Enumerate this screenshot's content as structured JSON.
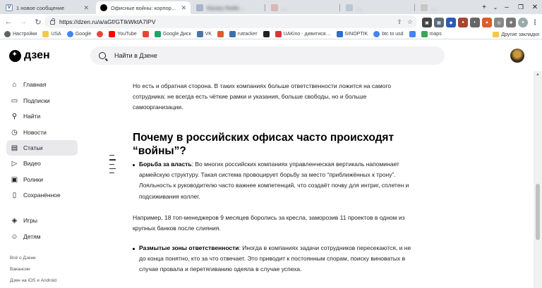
{
  "browser": {
    "tabs": [
      {
        "title": "1 новое сообщение",
        "favicon": "v-mail-icon"
      },
      {
        "title": "Офисные войны: корпоративн…",
        "favicon": "dzen-icon"
      },
      {
        "title": "Ranary Radio…",
        "favicon": "site-icon"
      },
      {
        "title": "…",
        "favicon": "site-icon"
      },
      {
        "title": "…",
        "favicon": "site-icon"
      },
      {
        "title": "…",
        "favicon": "site-icon"
      }
    ],
    "url": "https://dzen.ru/a/aGf/GTIkWktA7IPV",
    "bookmarks": [
      {
        "label": "Настройки",
        "color": "#5f6368"
      },
      {
        "label": "USA",
        "color": "#f2c94c"
      },
      {
        "label": "Google",
        "color": "#4285f4"
      },
      {
        "label": "",
        "color": "#e8453c"
      },
      {
        "label": "YouTube",
        "color": "#ff0000"
      },
      {
        "label": "",
        "color": "#ea4335"
      },
      {
        "label": "Google Диск",
        "color": "#1fa463"
      },
      {
        "label": "VK",
        "color": "#4a76a8"
      },
      {
        "label": "",
        "color": "#e05a2b"
      },
      {
        "label": "rutracker",
        "color": "#3a6fb0"
      },
      {
        "label": "",
        "color": "#222222"
      },
      {
        "label": "UAKino - дивитися…",
        "color": "#d33"
      },
      {
        "label": "SINOPTIK",
        "color": "#2d6fd1"
      },
      {
        "label": "btc to usd",
        "color": "#4285f4"
      },
      {
        "label": "",
        "color": "#4285f4"
      },
      {
        "label": "maps",
        "color": "#34a853"
      }
    ],
    "other_bookmarks": "Другие закладки"
  },
  "header": {
    "logo": "дзен",
    "search_placeholder": "Найти в Дзене"
  },
  "sidebar": {
    "items": [
      {
        "label": "Главная",
        "icon": "home-icon",
        "glyph": "⌂"
      },
      {
        "label": "Подписки",
        "icon": "subscriptions-icon",
        "glyph": "▭"
      },
      {
        "label": "Найти",
        "icon": "search-icon",
        "glyph": "⚲"
      },
      {
        "label": "Новости",
        "icon": "news-icon",
        "glyph": "◷"
      },
      {
        "label": "Статьи",
        "icon": "articles-icon",
        "glyph": "▤"
      },
      {
        "label": "Видео",
        "icon": "video-icon",
        "glyph": "▷"
      },
      {
        "label": "Ролики",
        "icon": "shorts-icon",
        "glyph": "▣"
      },
      {
        "label": "Сохранённое",
        "icon": "bookmark-icon",
        "glyph": "▯"
      },
      {
        "label": "Игры",
        "icon": "games-icon",
        "glyph": "◈"
      },
      {
        "label": "Детям",
        "icon": "kids-icon",
        "glyph": "☺"
      }
    ],
    "footer_links": [
      "Всё о Дзене",
      "Вакансии",
      "Дзен на iOS и Android"
    ]
  },
  "article": {
    "intro": "Но есть и обратная сторона. В таких компаниях больше ответственности ложится на самого сотрудника: не всегда есть чёткие рамки и указания, больше свободы, но и больше самоорганизации.",
    "heading": "Почему в российских офисах часто происходят “войны”?",
    "bullet1_bold": "Борьба за власть",
    "bullet1_text": ": Во многих российских компаниях управленческая вертикаль напоминает армейскую структуру. Такая система провоцирует борьбу за место “приближённых к трону”. Лояльность к руководителю часто важнее компетенций, что создаёт почву для интриг, сплетен и подсиживания коллег.",
    "example": "Например, 18 топ-менеджеров 9 месяцев боролись за кресла, заморозив 11 проектов в одном из крупных банков после слияния.",
    "bullet2_bold": "Размытые зоны ответственности",
    "bullet2_text": ": Иногда в компаниях задачи сотрудников пересекаются, и не до конца понятно, кто за что отвечает. Это приводит к постоянным спорам, поиску виноватых в случае провала и перетягиванию одеяла в случае успеха."
  }
}
